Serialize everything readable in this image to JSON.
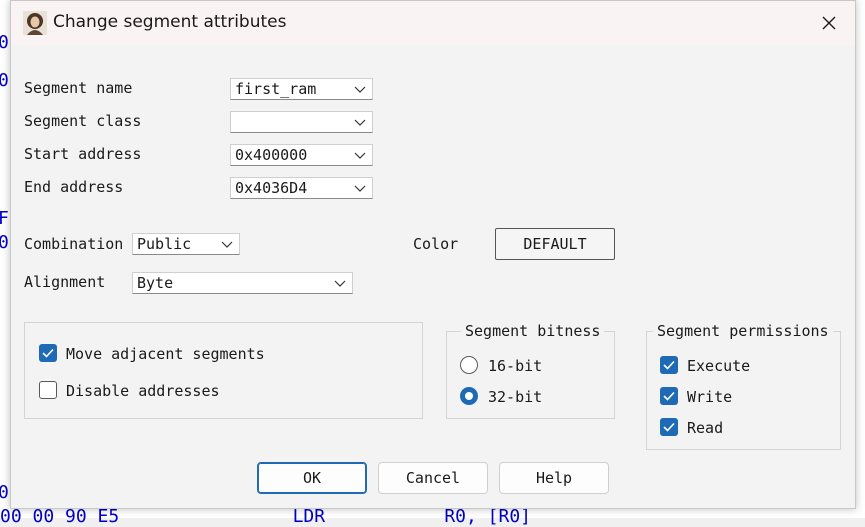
{
  "background": {
    "left_glyphs": [
      "0",
      "0",
      "F",
      "0",
      "0"
    ],
    "bottom_line": "00 00 90 E5                LDR           R0, [R0]"
  },
  "dialog": {
    "title": "Change segment attributes",
    "fields": {
      "segment_name": {
        "label": "Segment name",
        "value": "first_ram"
      },
      "segment_class": {
        "label": "Segment class",
        "value": ""
      },
      "start_address": {
        "label": "Start address",
        "value": "0x400000"
      },
      "end_address": {
        "label": "End address",
        "value": "0x4036D4"
      },
      "combination": {
        "label": "Combination",
        "value": "Public"
      },
      "alignment": {
        "label": "Alignment",
        "value": "Byte"
      },
      "color": {
        "label": "Color",
        "button": "DEFAULT"
      }
    },
    "options": {
      "move_adjacent": {
        "label": "Move adjacent segments",
        "checked": true
      },
      "disable_addresses": {
        "label": "Disable addresses",
        "checked": false
      }
    },
    "bitness": {
      "title": "Segment bitness",
      "options": [
        {
          "label": "16-bit",
          "selected": false
        },
        {
          "label": "32-bit",
          "selected": true
        }
      ]
    },
    "permissions": {
      "title": "Segment permissions",
      "items": [
        {
          "label": "Execute",
          "checked": true
        },
        {
          "label": "Write",
          "checked": true
        },
        {
          "label": "Read",
          "checked": true
        }
      ]
    },
    "buttons": {
      "ok": "OK",
      "cancel": "Cancel",
      "help": "Help"
    }
  },
  "colors": {
    "accent": "#1f6ab5",
    "ide_text": "#0000c8"
  },
  "icons": {
    "app": "portrait-icon",
    "close": "close-icon",
    "dropdown": "chevron-down-icon",
    "check": "checkmark-icon"
  }
}
